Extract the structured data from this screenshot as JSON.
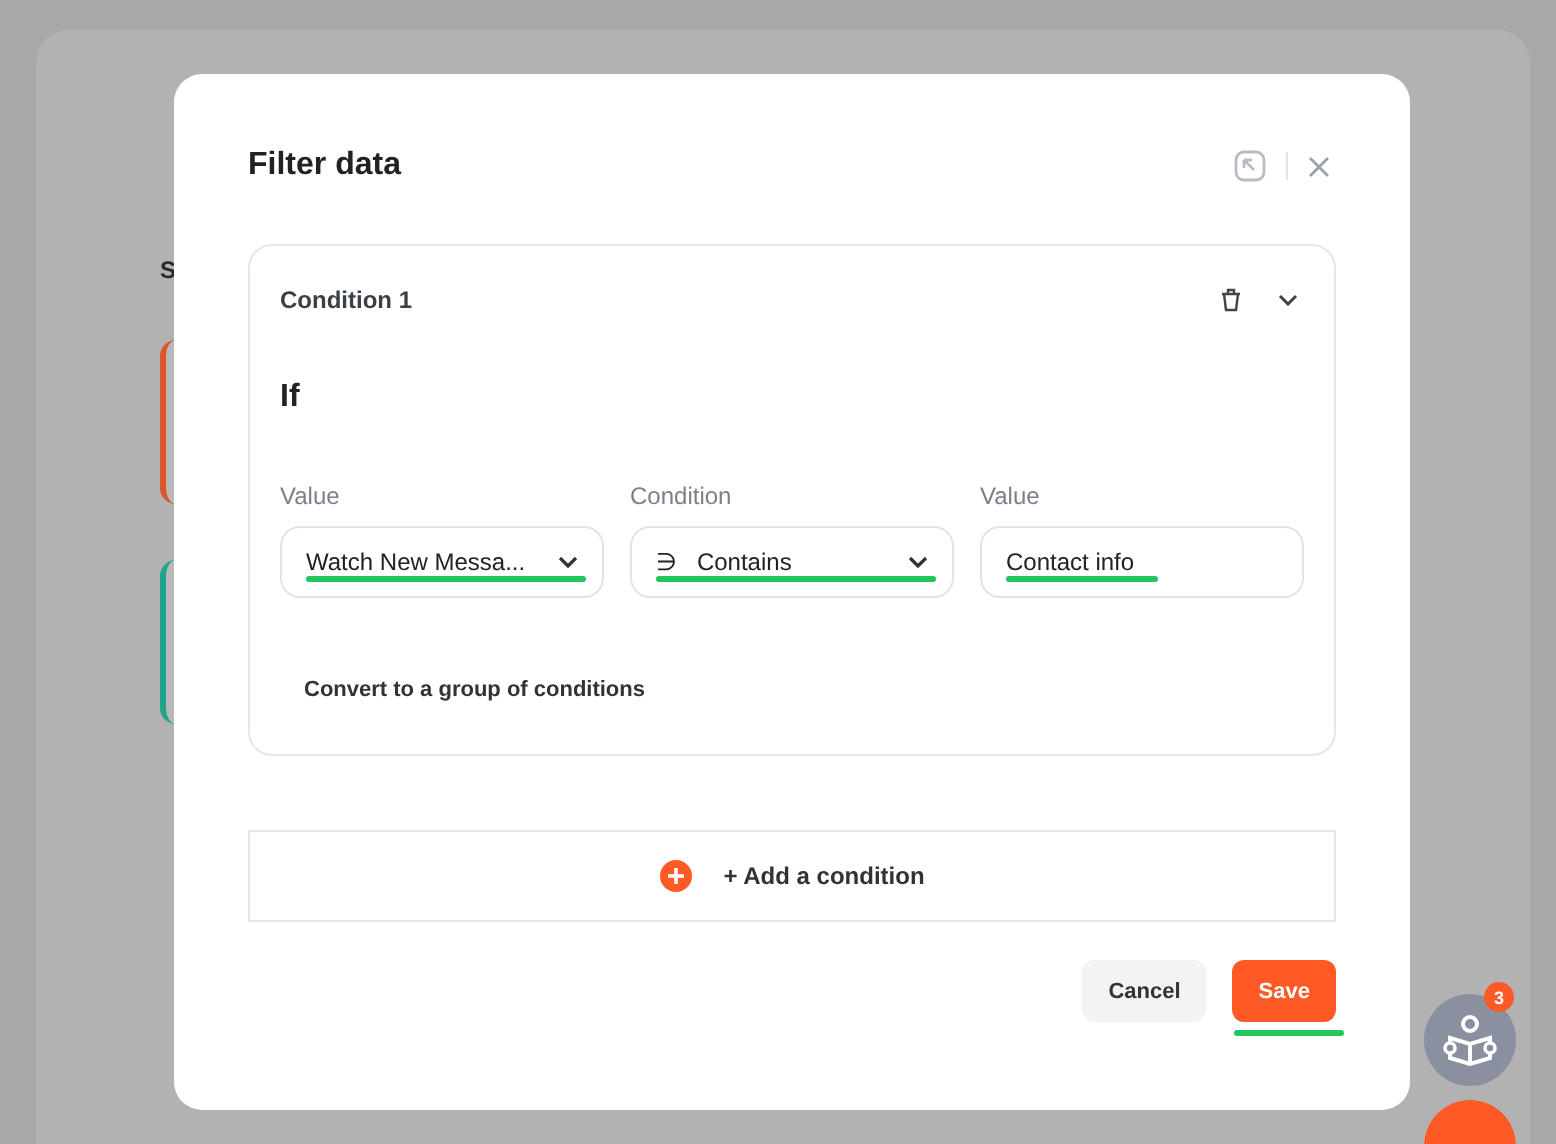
{
  "background": {
    "subheading": "S",
    "cards": [
      {
        "color": "#d9552b"
      },
      {
        "color": "#1fa58c"
      }
    ]
  },
  "modal": {
    "title": "Filter data",
    "condition": {
      "title": "Condition 1",
      "expanded": true,
      "if_label": "If",
      "fields": [
        {
          "kind": "select",
          "label": "Value",
          "value": "Watch New Messa...",
          "underlined": true
        },
        {
          "kind": "select",
          "label": "Condition",
          "value": "Contains",
          "prefix": "∋",
          "underlined": true
        },
        {
          "kind": "text",
          "label": "Value",
          "value": "Contact info",
          "underlined": true
        }
      ],
      "convert_link": "Convert to a group of conditions"
    },
    "add_condition": "+ Add a condition",
    "buttons": [
      {
        "kind": "secondary",
        "label": "Cancel"
      },
      {
        "kind": "primary",
        "label": "Save",
        "underlined": true
      }
    ]
  },
  "help": {
    "badge": "3"
  }
}
